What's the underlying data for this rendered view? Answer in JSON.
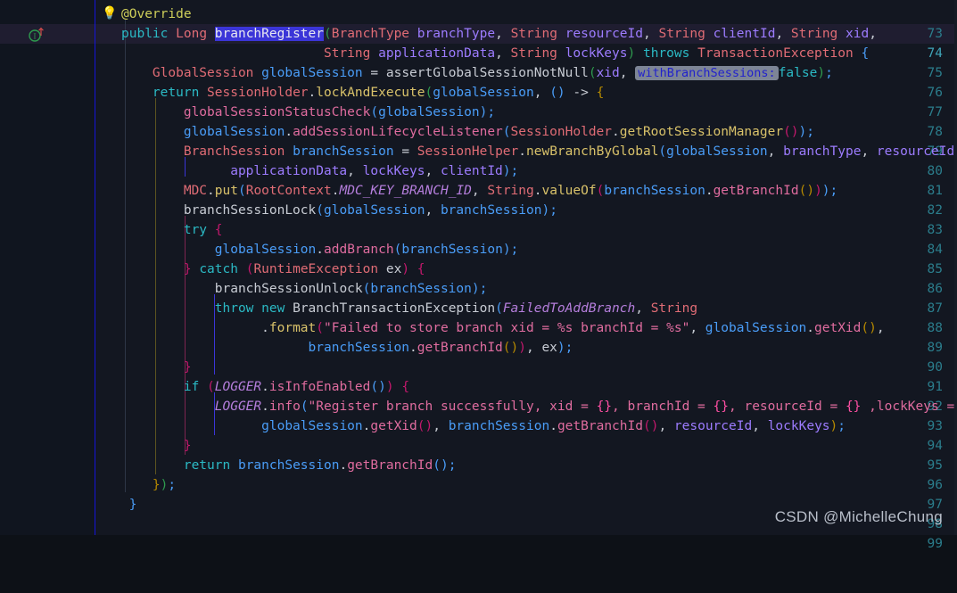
{
  "editor": {
    "theme": "dark",
    "language": "Java",
    "background_color": "#131721",
    "gutter_color": "#10151f",
    "caret_line_color": "#1f1d30",
    "line_number_color": "#2b7d8c",
    "caret_line_number": 74,
    "first_visible_line": 73,
    "last_visible_line": 99
  },
  "gutter": {
    "icons": [
      {
        "line": 73,
        "name": "intention-bulb-icon",
        "glyph": "💡"
      },
      {
        "line": 74,
        "name": "implementing-method-icon",
        "glyph": "I↑"
      }
    ],
    "line_numbers": [
      73,
      74,
      75,
      76,
      77,
      78,
      79,
      80,
      81,
      82,
      83,
      84,
      85,
      86,
      87,
      88,
      89,
      90,
      91,
      92,
      93,
      94,
      95,
      96,
      97,
      98,
      99
    ]
  },
  "selection": {
    "text": "branchRegister",
    "line": 74,
    "background_color": "#3b35d8"
  },
  "inlay_hints": [
    {
      "line": 76,
      "text": "withBranchSessions:",
      "background_color": "#7d8596",
      "text_color": "#2222cc"
    }
  ],
  "watermark": {
    "text": "CSDN @MichelleChung"
  },
  "syntax_colors": {
    "keyword": "#2bbac5",
    "class_name": "#e06c75",
    "local_variable": "#4a9df8",
    "parameter": "#9d7cff",
    "method_call": "#e06c9f",
    "static_method": "#d9c26a",
    "static_field": "#b57edc",
    "string": "#e06c9f",
    "string_placeholder": "#ff4fa3",
    "annotation": "#cfcf5a",
    "default_text": "#c8ccd4"
  },
  "code": {
    "lines": [
      {
        "number": 73,
        "text": "@Override"
      },
      {
        "number": 74,
        "text": "public Long branchRegister(BranchType branchType, String resourceId, String clientId, String xid,"
      },
      {
        "number": 75,
        "text": "                          String applicationData, String lockKeys) throws TransactionException {"
      },
      {
        "number": 76,
        "text": "    GlobalSession globalSession = assertGlobalSessionNotNull(xid, withBranchSessions: false);"
      },
      {
        "number": 77,
        "text": "    return SessionHolder.lockAndExecute(globalSession, () -> {"
      },
      {
        "number": 78,
        "text": "        globalSessionStatusCheck(globalSession);"
      },
      {
        "number": 79,
        "text": "        globalSession.addSessionLifecycleListener(SessionHolder.getRootSessionManager());"
      },
      {
        "number": 80,
        "text": "        BranchSession branchSession = SessionHelper.newBranchByGlobal(globalSession, branchType, resourceId,"
      },
      {
        "number": 81,
        "text": "              applicationData, lockKeys, clientId);"
      },
      {
        "number": 82,
        "text": "        MDC.put(RootContext.MDC_KEY_BRANCH_ID, String.valueOf(branchSession.getBranchId()));"
      },
      {
        "number": 83,
        "text": "        branchSessionLock(globalSession, branchSession);"
      },
      {
        "number": 84,
        "text": "        try {"
      },
      {
        "number": 85,
        "text": "            globalSession.addBranch(branchSession);"
      },
      {
        "number": 86,
        "text": "        } catch (RuntimeException ex) {"
      },
      {
        "number": 87,
        "text": "            branchSessionUnlock(branchSession);"
      },
      {
        "number": 88,
        "text": "            throw new BranchTransactionException(FailedToAddBranch, String"
      },
      {
        "number": 89,
        "text": "                  .format(\"Failed to store branch xid = %s branchId = %s\", globalSession.getXid(),"
      },
      {
        "number": 90,
        "text": "                        branchSession.getBranchId()), ex);"
      },
      {
        "number": 91,
        "text": "        }"
      },
      {
        "number": 92,
        "text": "        if (LOGGER.isInfoEnabled()) {"
      },
      {
        "number": 93,
        "text": "            LOGGER.info(\"Register branch successfully, xid = {}, branchId = {}, resourceId = {} ,lockKeys = {}\","
      },
      {
        "number": 94,
        "text": "                  globalSession.getXid(), branchSession.getBranchId(), resourceId, lockKeys);"
      },
      {
        "number": 95,
        "text": "        }"
      },
      {
        "number": 96,
        "text": "        return branchSession.getBranchId();"
      },
      {
        "number": 97,
        "text": "    });"
      },
      {
        "number": 98,
        "text": "}"
      },
      {
        "number": 99,
        "text": ""
      }
    ]
  }
}
